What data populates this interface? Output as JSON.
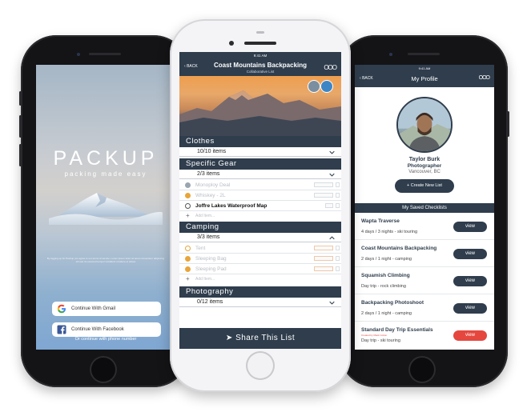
{
  "login": {
    "logo": "PACKUP",
    "tagline": "packing made easy",
    "fine_print": "By logging up for Packup you agree to our terms of service. Lorem ipsum dolor sit amet consectetur adipiscing elit sed do eiusmod tempor incididunt ut labore et dolore",
    "gmail_button": "Continue With Gmail",
    "facebook_button": "Continue With Facebook",
    "phone_link": "Or continue with phone number"
  },
  "list": {
    "status_time": "9:41 AM",
    "back": "BACK",
    "title": "Coast Mountains Backpacking",
    "subtitle": "Collaborative List",
    "more": "OOO",
    "add_placeholder": "Add Item...",
    "share_button": "Share This List",
    "sections": [
      {
        "name": "Clothes",
        "count": "10/10 items"
      },
      {
        "name": "Specific Gear",
        "count": "2/3 items",
        "items": [
          "Monoploy Deal",
          "Whiskey - 2L",
          "Joffre Lakes Waterproof Map"
        ]
      },
      {
        "name": "Camping",
        "count": "3/3 items",
        "items": [
          "Tent",
          "Sleeping Bag",
          "Sleeping Pad"
        ]
      },
      {
        "name": "Photography",
        "count": "0/12 items"
      }
    ]
  },
  "profile": {
    "status_time": "9:41 AM",
    "back": "BACK",
    "title": "My Profile",
    "more": "OOO",
    "name": "Taylor Burk",
    "role": "Photographer",
    "location": "Vancouver, BC",
    "create_button": "Create New List",
    "saved_heading": "My Saved Checklists",
    "view_label": "view",
    "checklists": [
      {
        "name": "Wapta Traverse",
        "meta": "4 days / 3 nights - ski touring"
      },
      {
        "name": "Coast Mountains Backpacking",
        "meta": "2 days / 1 night - camping"
      },
      {
        "name": "Squamish Climbing",
        "meta": "Day trip - rock climbing"
      },
      {
        "name": "Backpacking Photoshoot",
        "meta": "2 days / 1 night - camping"
      },
      {
        "name": "Standard Day Trip Essentials",
        "note": "Created by Mack Colton",
        "meta": "Day trip - ski touring"
      }
    ]
  },
  "colors": {
    "navy": "#2f3d4d",
    "alert_red": "#e5473f",
    "check_gold": "#e8a53a"
  }
}
